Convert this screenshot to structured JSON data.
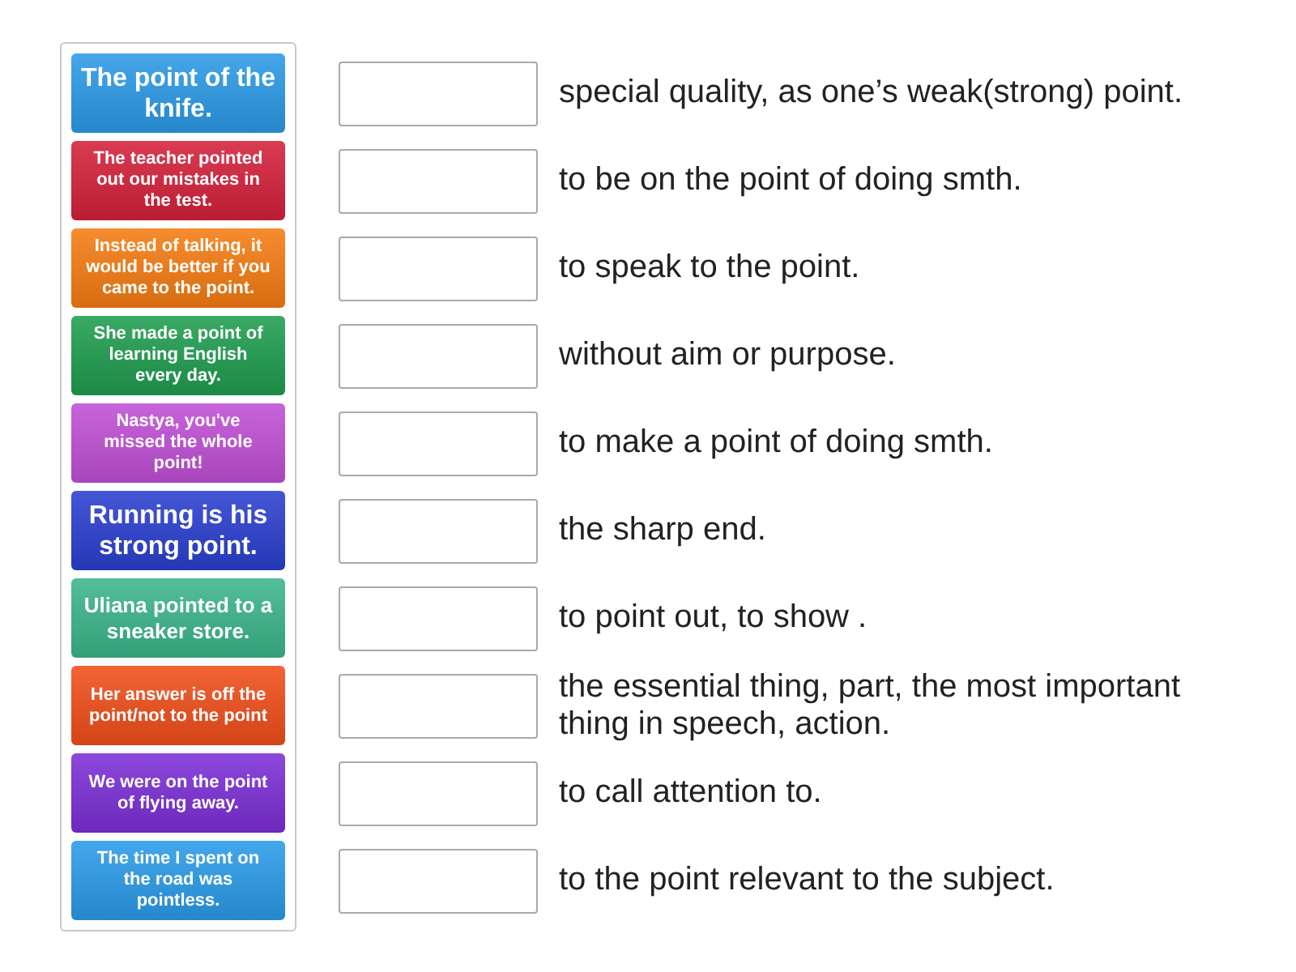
{
  "tiles": [
    {
      "text": "The point of the knife.",
      "color": "#2b9ae6"
    },
    {
      "text": "The teacher pointed out our mistakes in the test.",
      "color": "#d4213a"
    },
    {
      "text": "Instead of talking, it would be better if you came to the point.",
      "color": "#f57c12"
    },
    {
      "text": "She made a point of learning English every day.",
      "color": "#1f9d4f"
    },
    {
      "text": "Nastya, you've missed the whole point!",
      "color": "#c04fd6"
    },
    {
      "text": "Running is his strong point.",
      "color": "#2a3fcf"
    },
    {
      "text": "Uliana pointed to a sneaker store.",
      "color": "#3bb58a"
    },
    {
      "text": "Her answer is off the point/not to the point",
      "color": "#f04e1a"
    },
    {
      "text": "We were on the point of flying away.",
      "color": "#7b2fd6"
    },
    {
      "text": "The time I spent on the road was pointless.",
      "color": "#2a9be8"
    }
  ],
  "definitions": [
    "special quality, as one’s weak(strong) point.",
    "to be on the point of doing smth.",
    "to speak to the point.",
    "without aim or purpose.",
    "to make a point of doing smth.",
    "the sharp end.",
    "to point out, to show .",
    "the essential thing, part, the most important thing in speech, action.",
    "to call attention to.",
    "to the point relevant to the subject."
  ]
}
